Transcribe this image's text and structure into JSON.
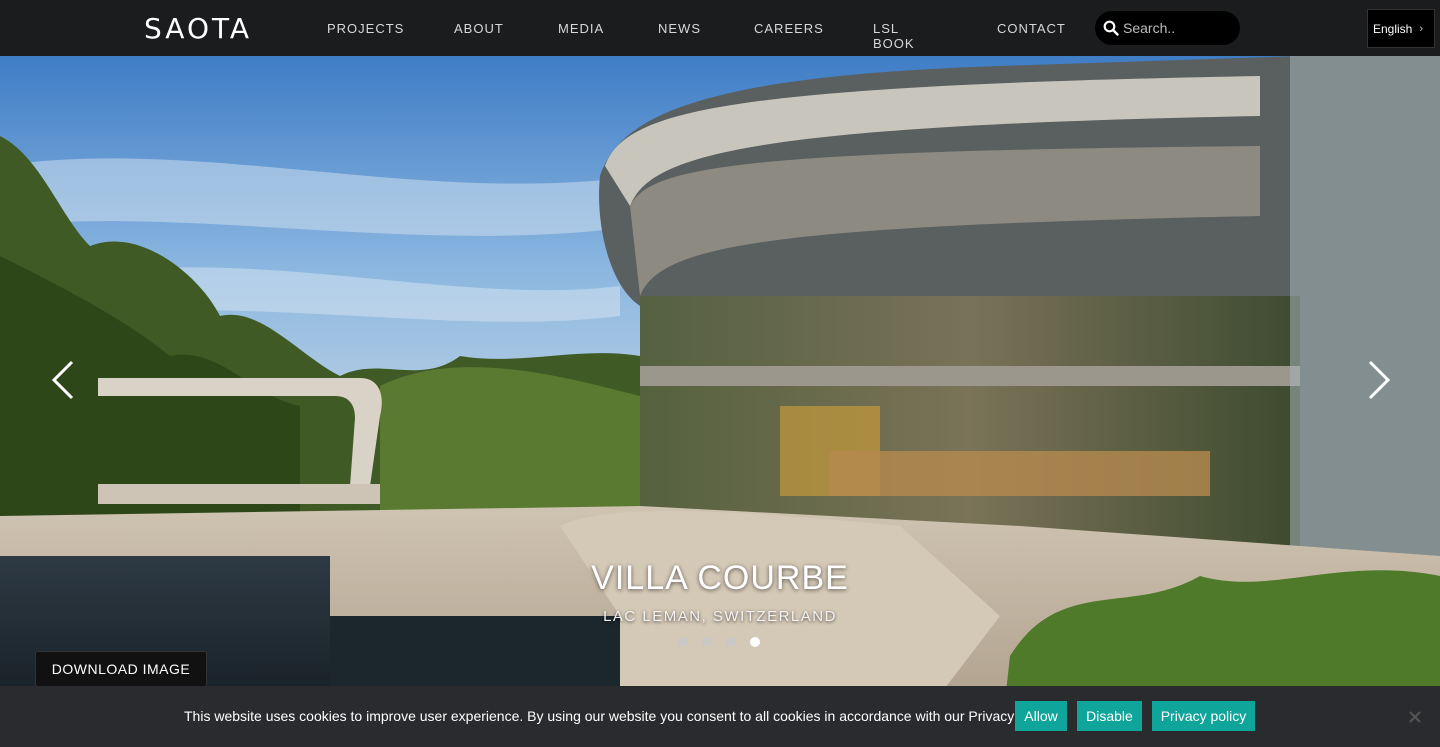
{
  "brand": {
    "logo": "SAOTA"
  },
  "nav": {
    "items": [
      {
        "label": "PROJECTS"
      },
      {
        "label": "ABOUT"
      },
      {
        "label": "MEDIA"
      },
      {
        "label": "NEWS"
      },
      {
        "label": "CAREERS"
      },
      {
        "label": "LSL BOOK"
      },
      {
        "label": "CONTACT"
      }
    ],
    "search_placeholder": "Search..",
    "language": "English"
  },
  "slider": {
    "title": "VILLA COURBE",
    "subtitle": "LAC LEMAN, SWITZERLAND",
    "slide_count": 4,
    "active_slide": 4,
    "download_label": "DOWNLOAD IMAGE"
  },
  "cookie_bar": {
    "message": "This website uses cookies to improve user experience. By using our website you consent to all cookies in accordance with our Privacy Policy.",
    "allow_label": "Allow",
    "disable_label": "Disable",
    "privacy_label": "Privacy policy"
  },
  "colors": {
    "nav_bg": "#1b1c1e",
    "accent": "#10a59a",
    "cookie_bg": "#2a2b2e"
  }
}
